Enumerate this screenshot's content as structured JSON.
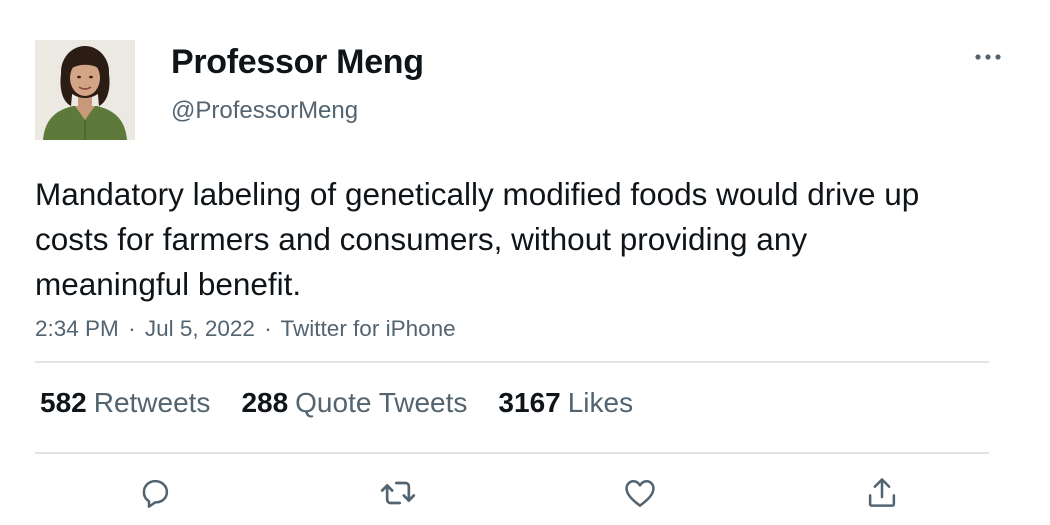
{
  "author": {
    "name": "Professor Meng",
    "handle": "@ProfessorMeng"
  },
  "tweet": {
    "text": "Mandatory labeling of genetically modified foods would drive up costs for farmers and consumers, without providing any meaningful benefit.",
    "time": "2:34 PM",
    "date": "Jul 5, 2022",
    "source": "Twitter for iPhone",
    "separator": "·"
  },
  "stats": {
    "retweets": {
      "count": "582",
      "label": "Retweets"
    },
    "quotes": {
      "count": "288",
      "label": "Quote Tweets"
    },
    "likes": {
      "count": "3167",
      "label": "Likes"
    }
  },
  "icons": {
    "more": "more-horizontal-icon",
    "reply": "reply-icon",
    "retweet": "retweet-icon",
    "like": "heart-icon",
    "share": "share-icon"
  },
  "colors": {
    "text": "#0f1419",
    "secondary": "#536471",
    "divider": "#e1e4e7",
    "icon": "#536471"
  }
}
